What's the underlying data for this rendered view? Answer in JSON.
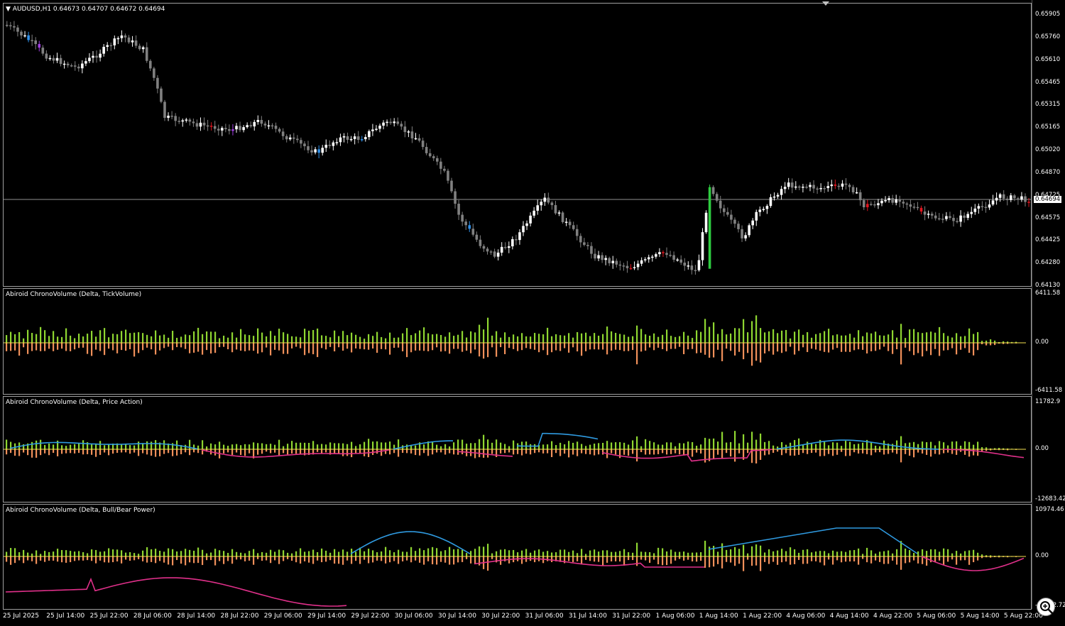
{
  "symbol_header": {
    "arrow": "▼",
    "text": "AUDUSD,H1  0.64673 0.64707 0.64672 0.64694"
  },
  "price_axis": {
    "ticks": [
      "0.65905",
      "0.65760",
      "0.65610",
      "0.65465",
      "0.65315",
      "0.65165",
      "0.65020",
      "0.64870",
      "0.64725",
      "0.64575",
      "0.64425",
      "0.64280",
      "0.64130"
    ],
    "current_price": "0.64694"
  },
  "sub_panels": [
    {
      "title": "Abiroid ChronoVolume (Delta, TickVolume)",
      "top_value": "6411.58",
      "zero_value": "0.00",
      "bottom_value": "-6411.58"
    },
    {
      "title": "Abiroid ChronoVolume (Delta, Price Action)",
      "top_value": "11782.9",
      "zero_value": "0.00",
      "bottom_value": "-12683.42"
    },
    {
      "title": "Abiroid ChronoVolume (Delta, Bull/Bear Power)",
      "top_value": "10974.46",
      "zero_value": "0.00",
      "bottom_value": "-11082.72"
    }
  ],
  "time_axis": [
    "25 Jul 2025",
    "25 Jul 14:00",
    "25 Jul 22:00",
    "28 Jul 06:00",
    "28 Jul 14:00",
    "28 Jul 22:00",
    "29 Jul 06:00",
    "29 Jul 14:00",
    "29 Jul 22:00",
    "30 Jul 06:00",
    "30 Jul 14:00",
    "30 Jul 22:00",
    "31 Jul 06:00",
    "31 Jul 14:00",
    "31 Jul 22:00",
    "1 Aug 06:00",
    "1 Aug 14:00",
    "1 Aug 22:00",
    "4 Aug 06:00",
    "4 Aug 14:00",
    "4 Aug 22:00",
    "5 Aug 06:00",
    "5 Aug 14:00",
    "5 Aug 22:00"
  ],
  "colors": {
    "background": "#000000",
    "bull_candle": "#ffffff",
    "bear_candle": "#808080",
    "signal_red": "#e0161f",
    "signal_blue": "#2f8fe8",
    "signal_purple": "#a040e0",
    "signal_green": "#2ecc40",
    "delta_up": "#8fd631",
    "delta_down": "#f0905a",
    "zero_line": "#f5e050",
    "line_up": "#2f9ae0",
    "line_down": "#e0308a"
  },
  "zoom_icon": "magnifier-zoom-icon"
}
